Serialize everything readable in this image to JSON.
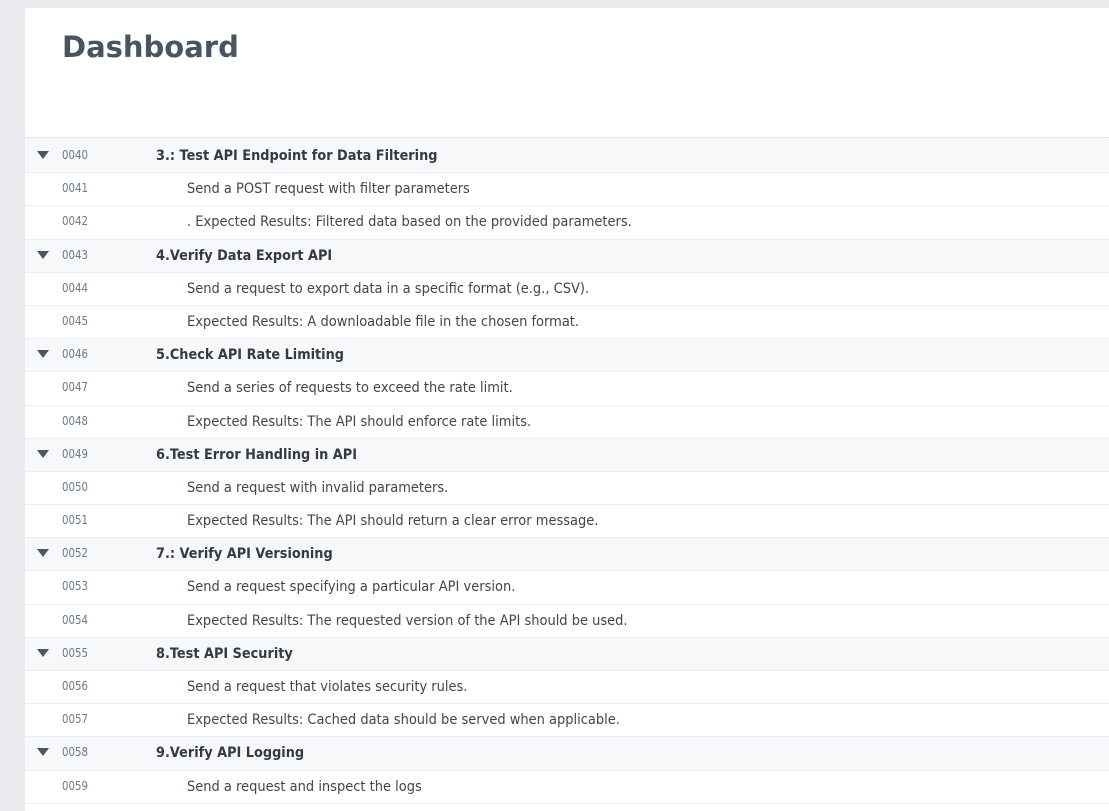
{
  "header": {
    "title": "Dashboard"
  },
  "rows": [
    {
      "line": "0040",
      "text": "3.: Test API Endpoint for Data Filtering",
      "type": "group"
    },
    {
      "line": "0041",
      "text": "Send a POST request with filter parameters",
      "type": "item"
    },
    {
      "line": "0042",
      "text": ". Expected Results: Filtered data based on the provided parameters.",
      "type": "item"
    },
    {
      "line": "0043",
      "text": "4.Verify Data Export API",
      "type": "group"
    },
    {
      "line": "0044",
      "text": "Send a request to export data in a specific format (e.g., CSV).",
      "type": "item"
    },
    {
      "line": "0045",
      "text": "Expected Results: A downloadable file in the chosen format.",
      "type": "item"
    },
    {
      "line": "0046",
      "text": "5.Check API Rate Limiting",
      "type": "group"
    },
    {
      "line": "0047",
      "text": "Send a series of requests to exceed the rate limit.",
      "type": "item"
    },
    {
      "line": "0048",
      "text": "Expected Results: The API should enforce rate limits.",
      "type": "item"
    },
    {
      "line": "0049",
      "text": "6.Test Error Handling in API",
      "type": "group"
    },
    {
      "line": "0050",
      "text": "Send a request with invalid parameters.",
      "type": "item"
    },
    {
      "line": "0051",
      "text": "Expected Results: The API should return a clear error message.",
      "type": "item"
    },
    {
      "line": "0052",
      "text": "7.: Verify API Versioning",
      "type": "group"
    },
    {
      "line": "0053",
      "text": "Send a request specifying a particular API version.",
      "type": "item"
    },
    {
      "line": "0054",
      "text": "Expected Results: The requested version of the API should be used.",
      "type": "item"
    },
    {
      "line": "0055",
      "text": "8.Test API Security",
      "type": "group"
    },
    {
      "line": "0056",
      "text": "Send a request that violates security rules.",
      "type": "item"
    },
    {
      "line": "0057",
      "text": "Expected Results: Cached data should be served when applicable.",
      "type": "item"
    },
    {
      "line": "0058",
      "text": "9.Verify API Logging",
      "type": "group"
    },
    {
      "line": "0059",
      "text": "Send a request and inspect the logs",
      "type": "item"
    }
  ]
}
